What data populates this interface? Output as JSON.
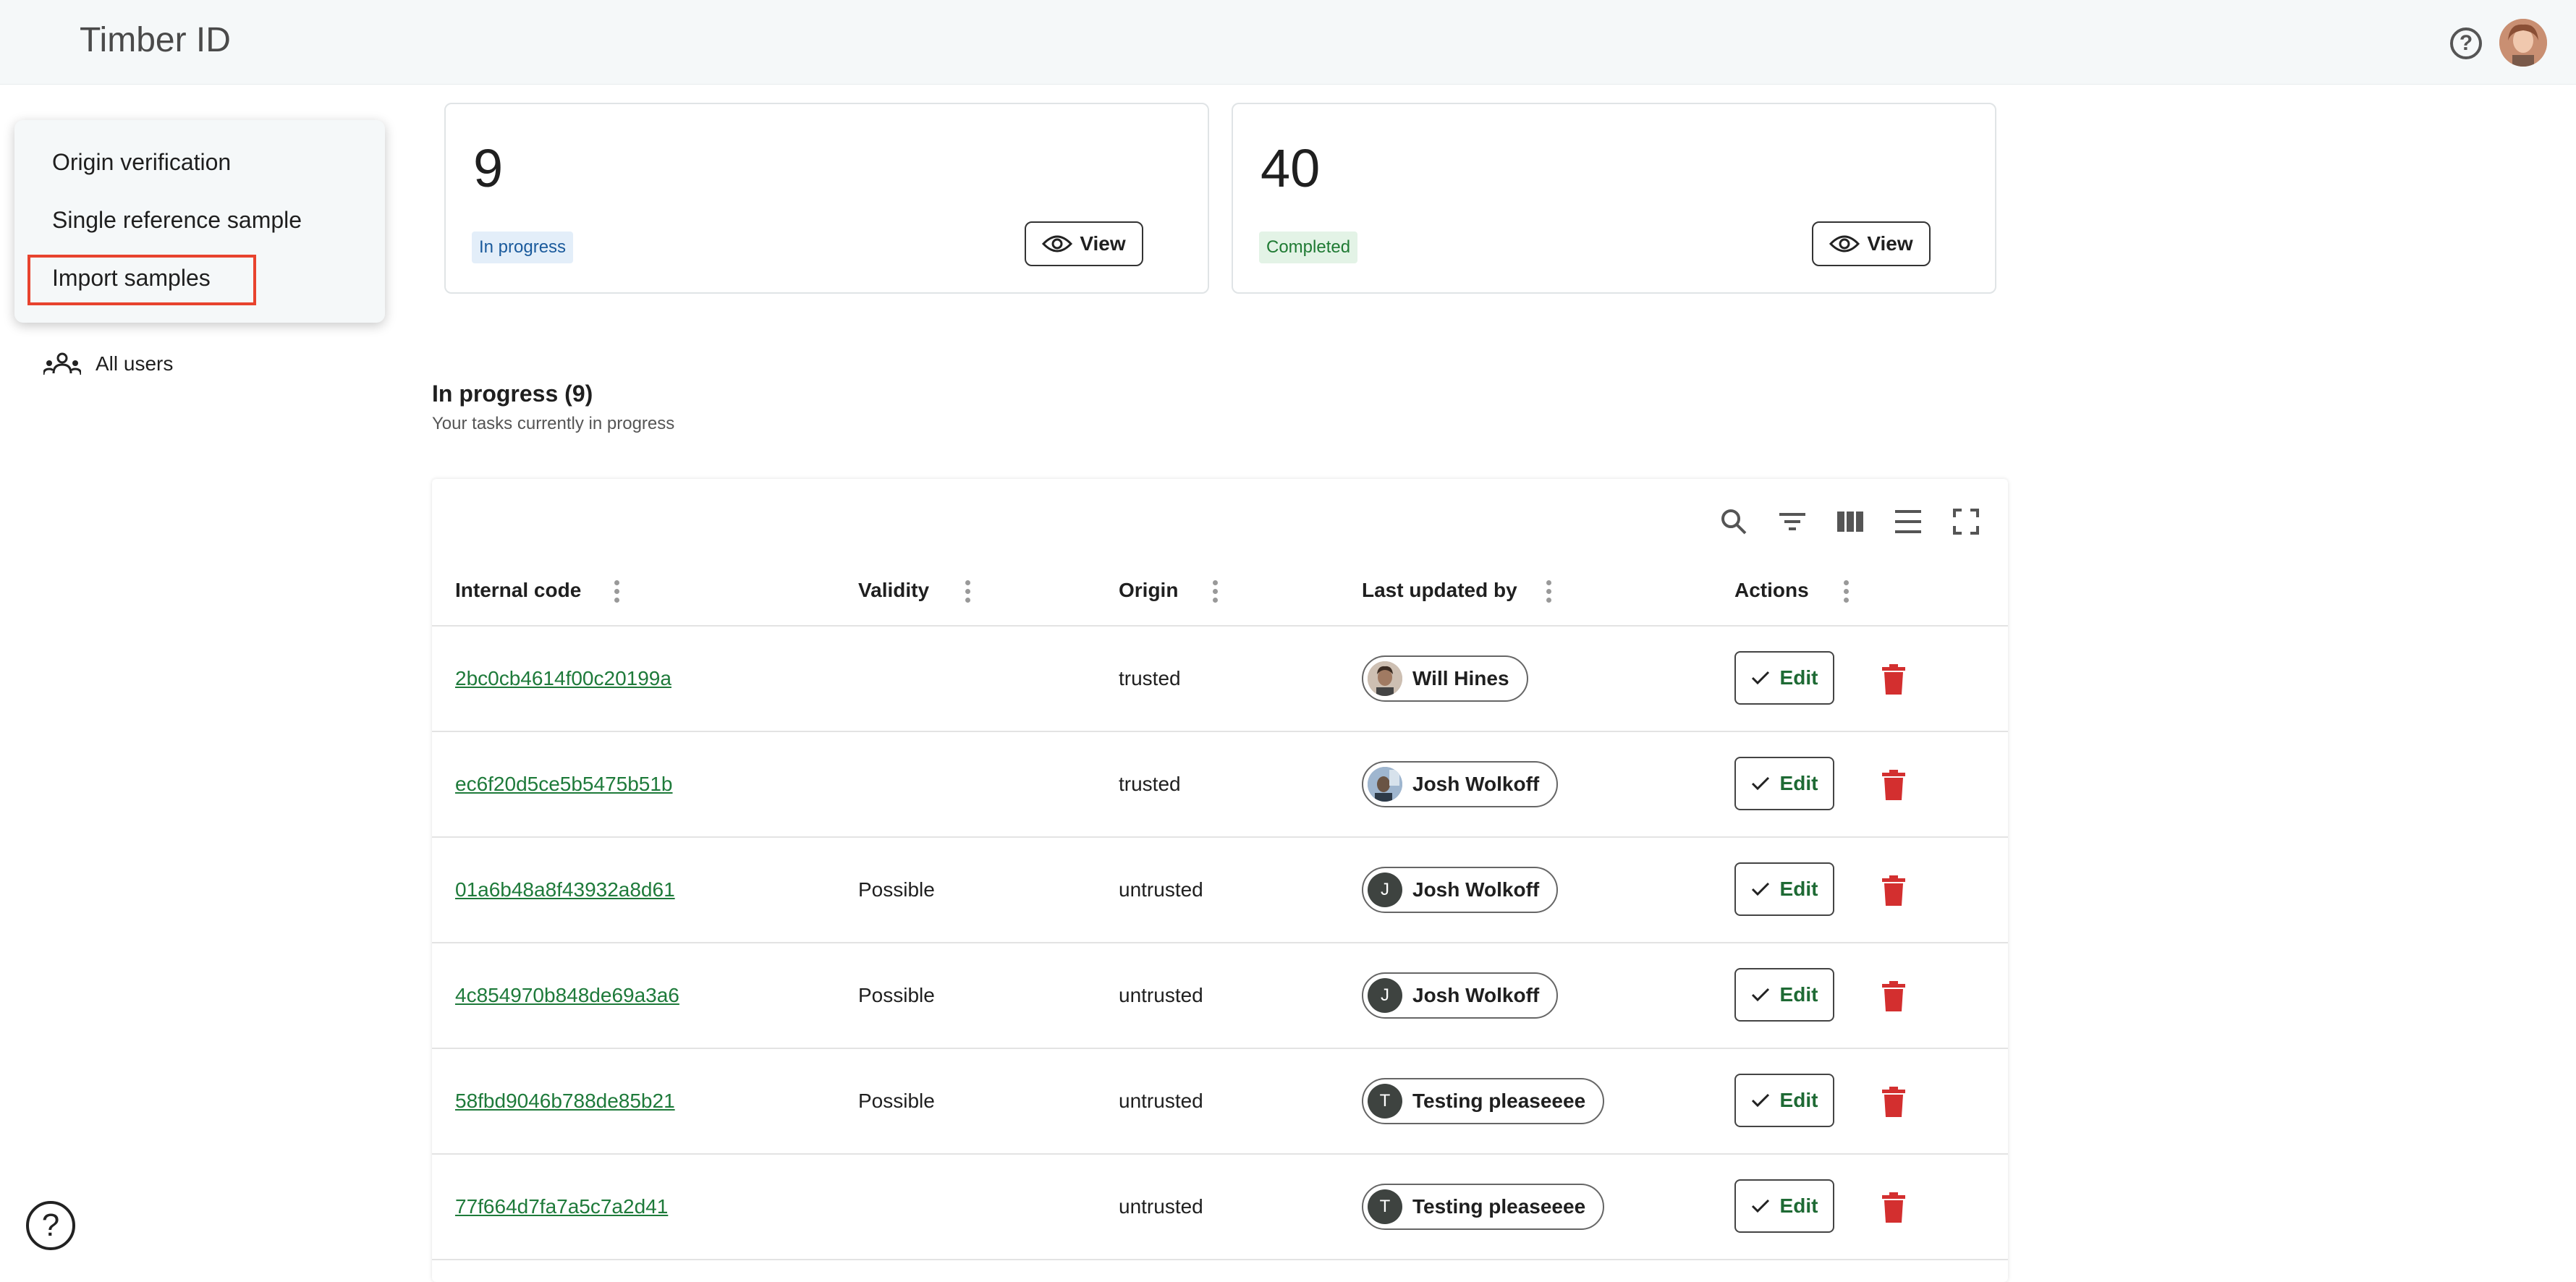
{
  "header": {
    "app_title": "Timber ID"
  },
  "menu": {
    "items": [
      {
        "label": "Origin verification"
      },
      {
        "label": "Single reference sample"
      },
      {
        "label": "Import samples"
      }
    ]
  },
  "nav": {
    "all_users_label": "All users"
  },
  "cards": [
    {
      "count": "9",
      "badge": "In progress",
      "view_label": "View"
    },
    {
      "count": "40",
      "badge": "Completed",
      "view_label": "View"
    }
  ],
  "section": {
    "title": "In progress (9)",
    "subtitle": "Your tasks currently in progress"
  },
  "table": {
    "columns": [
      "Internal code",
      "Validity",
      "Origin",
      "Last updated by",
      "Actions"
    ],
    "edit_label": "Edit",
    "rows": [
      {
        "code": "2bc0cb4614f00c20199a",
        "validity": "",
        "origin": "trusted",
        "user": "Will Hines",
        "avatar_letter": "",
        "avatar_type": "photo1"
      },
      {
        "code": "ec6f20d5ce5b5475b51b",
        "validity": "",
        "origin": "trusted",
        "user": "Josh Wolkoff",
        "avatar_letter": "",
        "avatar_type": "photo2"
      },
      {
        "code": "01a6b48a8f43932a8d61",
        "validity": "Possible",
        "origin": "untrusted",
        "user": "Josh Wolkoff",
        "avatar_letter": "J",
        "avatar_type": "letter"
      },
      {
        "code": "4c854970b848de69a3a6",
        "validity": "Possible",
        "origin": "untrusted",
        "user": "Josh Wolkoff",
        "avatar_letter": "J",
        "avatar_type": "letter"
      },
      {
        "code": "58fbd9046b788de85b21",
        "validity": "Possible",
        "origin": "untrusted",
        "user": "Testing pleaseeee",
        "avatar_letter": "T",
        "avatar_type": "letter"
      },
      {
        "code": "77f664d7fa7a5c7a2d41",
        "validity": "",
        "origin": "untrusted",
        "user": "Testing pleaseeee",
        "avatar_letter": "T",
        "avatar_type": "letter"
      }
    ]
  },
  "colors": {
    "link_green": "#1e7a3a",
    "delete_red": "#d32f2f",
    "highlight_border": "#e8432e"
  }
}
